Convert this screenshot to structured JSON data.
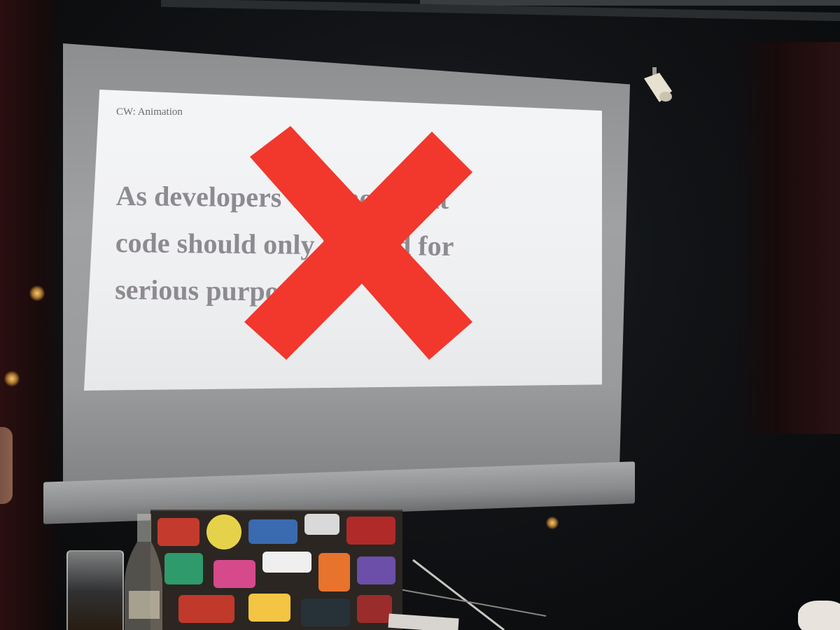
{
  "slide": {
    "corner_label": "CW: Animation",
    "lines": [
      "As developers we know that",
      "code should only be used for",
      "serious purposes"
    ],
    "overlay_icon": "red-cross-icon"
  },
  "colors": {
    "slide_text": "#8e8b90",
    "cross": "#f2372c",
    "slide_background": "#f2f3f5"
  }
}
